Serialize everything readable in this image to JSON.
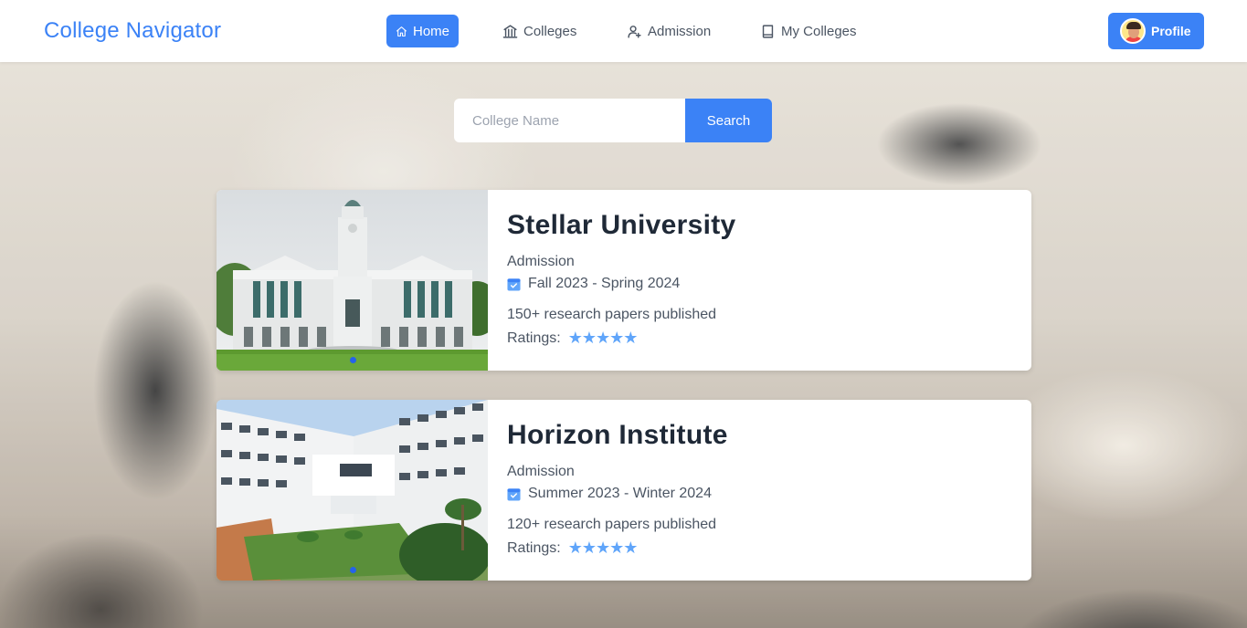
{
  "nav": {
    "brand": "College Navigator",
    "items": [
      {
        "label": "Home",
        "icon": "home-icon",
        "active": true
      },
      {
        "label": "Colleges",
        "icon": "building-columns-icon",
        "active": false
      },
      {
        "label": "Admission",
        "icon": "user-plus-icon",
        "active": false
      },
      {
        "label": "My Colleges",
        "icon": "book-icon",
        "active": false
      }
    ],
    "profile_label": "Profile"
  },
  "search": {
    "placeholder": "College Name",
    "value": "",
    "button_label": "Search"
  },
  "colleges": [
    {
      "name": "Stellar University",
      "admission_label": "Admission",
      "term": "Fall 2023 - Spring 2024",
      "papers": "150+ research papers published",
      "ratings_label": "Ratings:",
      "stars": "★★★★★",
      "rating": 5
    },
    {
      "name": "Horizon Institute",
      "admission_label": "Admission",
      "term": "Summer 2023 - Winter 2024",
      "papers": "120+ research papers published",
      "ratings_label": "Ratings:",
      "stars": "★★★★★",
      "rating": 5
    }
  ],
  "colors": {
    "accent": "#3b82f6",
    "star": "#60a5fa",
    "title": "#1f2937"
  }
}
